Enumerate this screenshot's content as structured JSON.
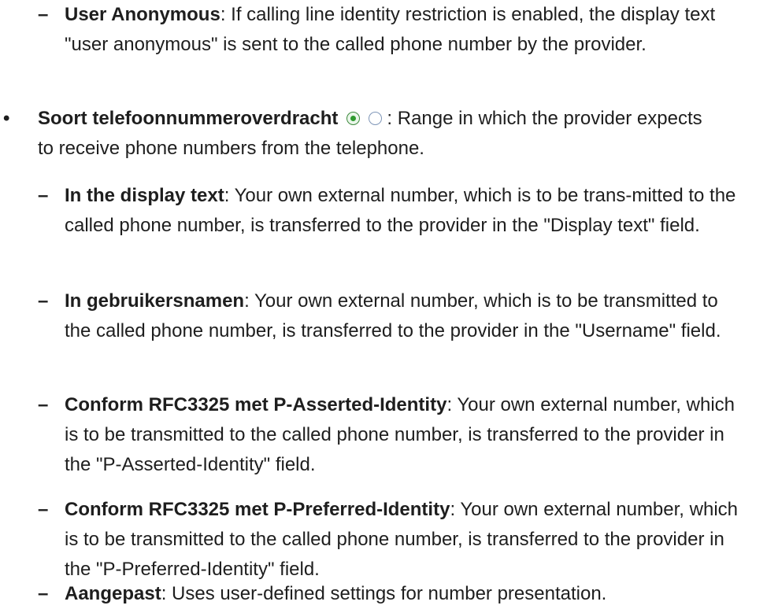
{
  "items": {
    "user_anonymous": {
      "dash": "–",
      "term": "User Anonymous",
      "text": ": If calling line identity restriction is enabled, the display text \"user anonymous\" is sent to the called phone number by the provider."
    },
    "soort": {
      "bullet": "•",
      "term": "Soort telefoonnummeroverdracht",
      "text": " : Range in which the provider expects to receive phone numbers from the telephone.",
      "radio_icons": [
        "radio-selected-icon",
        "radio-unselected-icon"
      ]
    },
    "display_text": {
      "dash": "–",
      "term": "In the display text",
      "text": ": Your own external number, which is to be trans-mitted to the called phone number, is transferred to the provider in the \"Display text\" field."
    },
    "gebruikersnamen": {
      "dash": "–",
      "term": "In gebruikersnamen",
      "text": ": Your own external number, which is to be transmitted to the called phone number, is transferred to the provider in the \"Username\" field."
    },
    "p_asserted": {
      "dash": "–",
      "term": "Conform RFC3325 met P-Asserted-Identity",
      "text": ": Your own external number, which is to be transmitted to the called phone number, is transferred to the provider in the \"P-Asserted-Identity\" field."
    },
    "p_preferred": {
      "dash": "–",
      "term": "Conform RFC3325 met P-Preferred-Identity",
      "text": ": Your own external number, which is to be transmitted to the called phone number, is transferred to the provider in the \"P-Preferred-Identity\" field."
    },
    "aangepast": {
      "dash": "–",
      "term": "Aangepast",
      "text": ": Uses user-defined settings for number presentation."
    }
  }
}
